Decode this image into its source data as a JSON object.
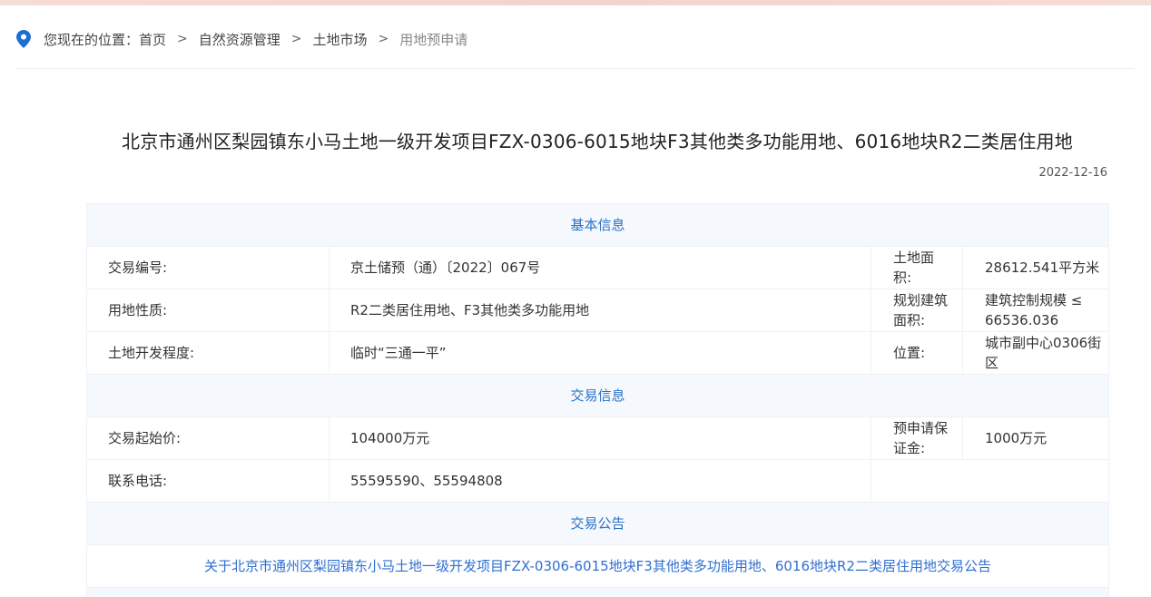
{
  "breadcrumb": {
    "prefix": "您现在的位置：",
    "items": [
      "首页",
      "自然资源管理",
      "土地市场",
      "用地预申请"
    ],
    "separator": ">"
  },
  "article": {
    "title": "北京市通州区梨园镇东小马土地一级开发项目FZX-0306-6015地块F3其他类多功能用地、6016地块R2二类居住用地",
    "date": "2022-12-16"
  },
  "sections": {
    "basic": "基本信息",
    "trade": "交易信息",
    "notice": "交易公告"
  },
  "basic_info": {
    "trade_no_label": "交易编号:",
    "trade_no": "京土储预（通）〔2022〕067号",
    "land_area_label": "土地面积:",
    "land_area": "28612.541平方米",
    "land_use_label": "用地性质:",
    "land_use": "R2二类居住用地、F3其他类多功能用地",
    "building_area_label": "规划建筑面积:",
    "building_area": "建筑控制规模 ≤ 66536.036",
    "dev_level_label": "土地开发程度:",
    "dev_level": "临时“三通一平”",
    "location_label": "位置:",
    "location": "城市副中心0306街区"
  },
  "trade_info": {
    "start_price_label": "交易起始价:",
    "start_price": "104000万元",
    "deposit_label": "预申请保证金:",
    "deposit": "1000万元",
    "phone_label": "联系电话:",
    "phone": "55595590、55594808"
  },
  "notice_link": "关于北京市通州区梨园镇东小马土地一级开发项目FZX-0306-6015地块F3其他类多功能用地、6016地块R2二类居住用地交易公告",
  "colors": {
    "accent": "#2a72c9",
    "section_bg": "#f5f8fc",
    "border": "#eef1f6"
  },
  "icons": {
    "location": "map-pin-icon"
  }
}
